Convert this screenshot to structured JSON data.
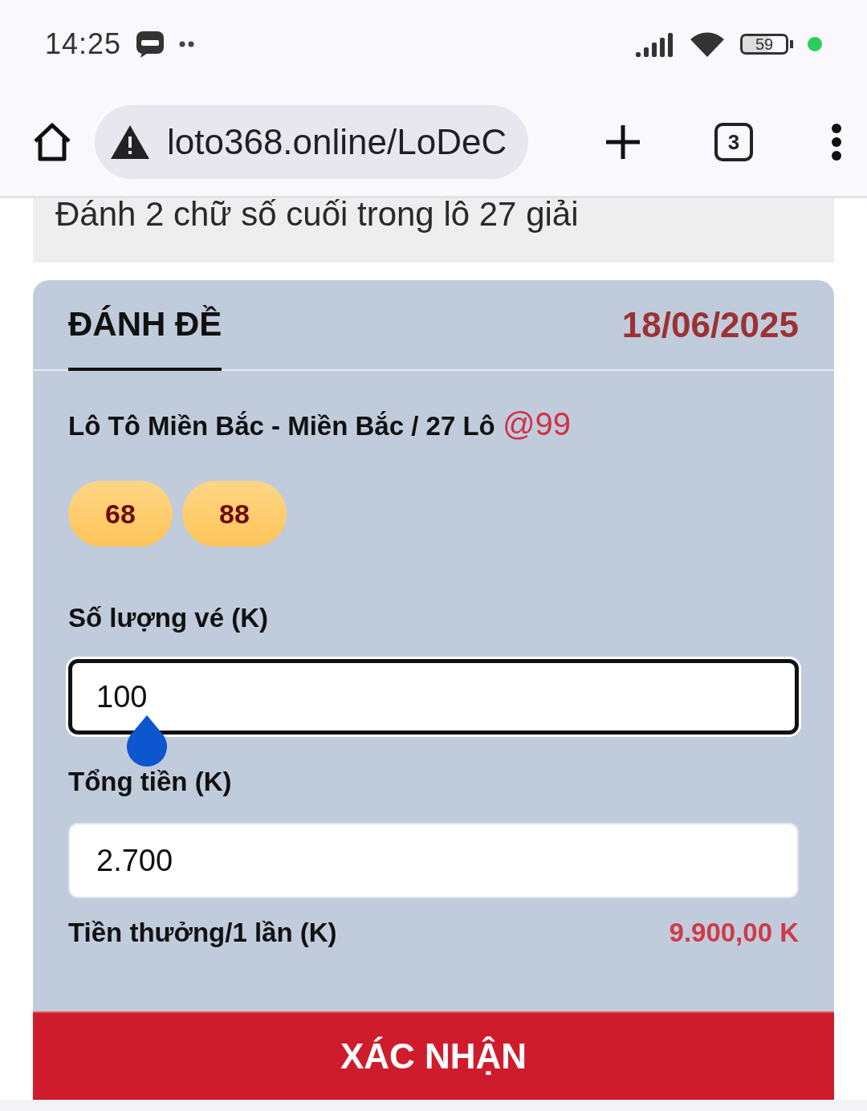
{
  "status_bar": {
    "time": "14:25",
    "battery": "59"
  },
  "browser": {
    "url": "loto368.online/LoDeC",
    "tab_count": "3"
  },
  "description": "Đánh 2 chữ số cuối trong lô 27 giải",
  "card": {
    "tabs": [
      {
        "label": "ĐÁNH ĐỀ",
        "selected": true
      }
    ],
    "date": "18/06/2025",
    "game": "Lô Tô Miền Bắc - Miền Bắc / 27 Lô",
    "odds": "@99",
    "numbers": [
      "68",
      "88"
    ],
    "fields": [
      {
        "label": "Số lượng vé (K)",
        "value": "100",
        "focused": true
      },
      {
        "label": "Tổng tiền (K)",
        "value": "2.700",
        "focused": false
      }
    ],
    "prize_label": "Tiền thưởng/1 lần (K)",
    "prize_value": "9.900,00 K",
    "submit": "XÁC NHẬN"
  }
}
